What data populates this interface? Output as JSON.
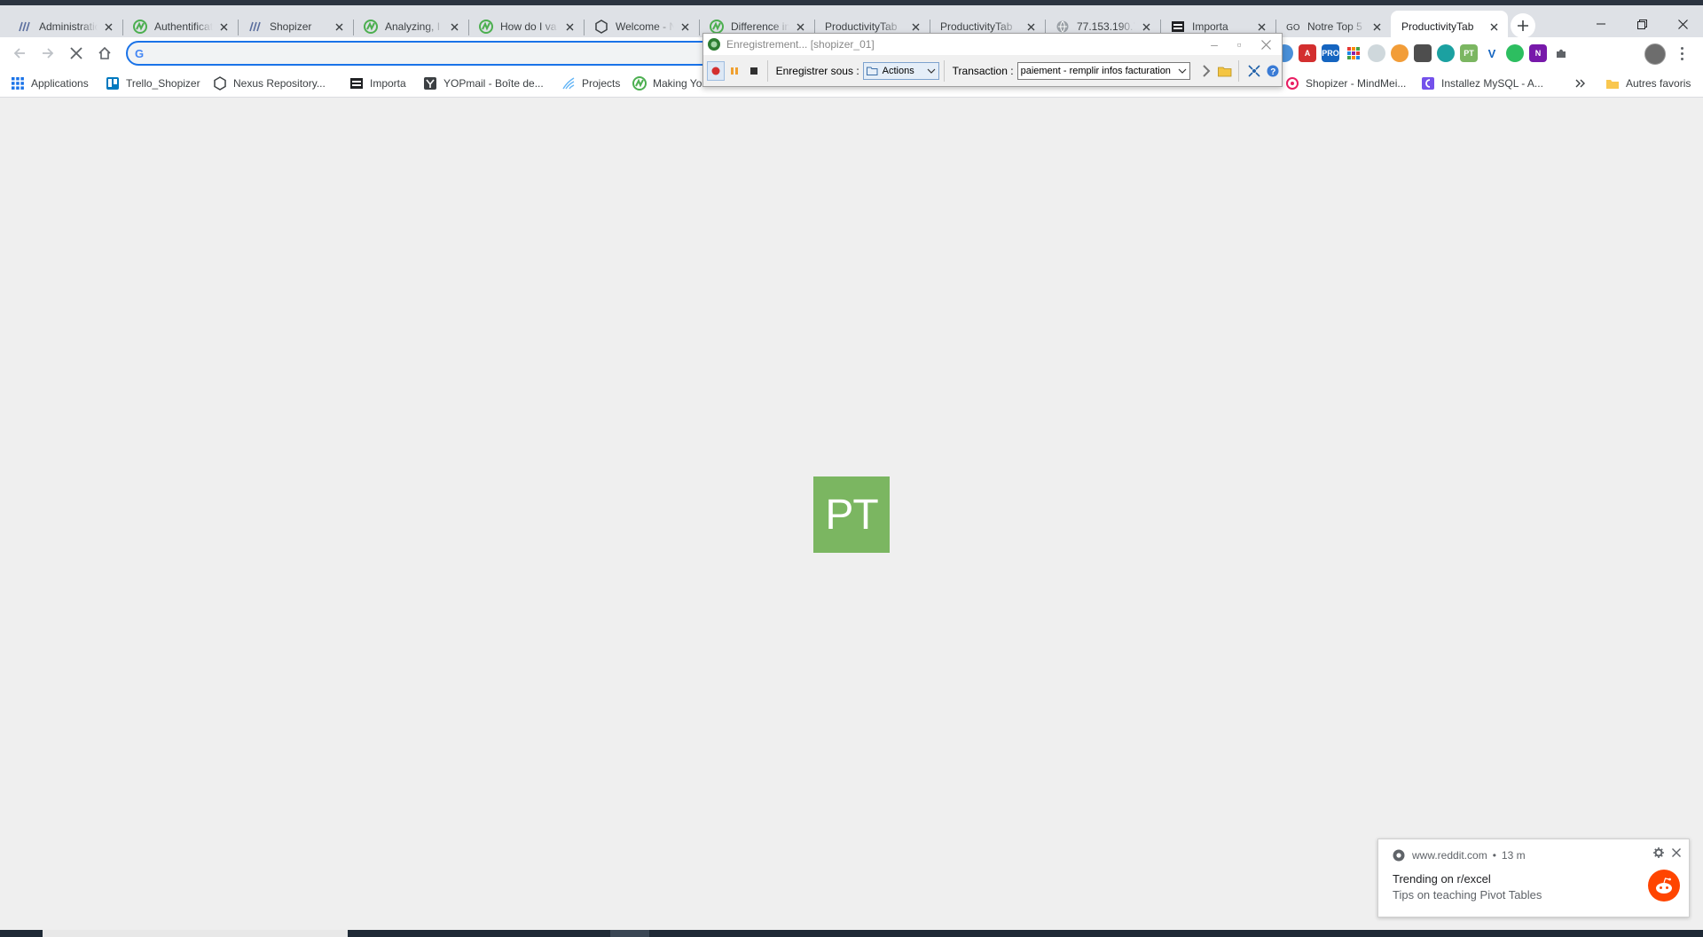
{
  "browser": {
    "tabs": [
      {
        "title": "Administratio",
        "icon": "hs-icon",
        "active": false
      },
      {
        "title": "Authentification",
        "icon": "n-green-icon",
        "active": false
      },
      {
        "title": "Shopizer",
        "icon": "hs-icon",
        "active": false
      },
      {
        "title": "Analyzing, I",
        "icon": "n-green-icon",
        "active": false
      },
      {
        "title": "How do I va",
        "icon": "n-green-icon",
        "active": false
      },
      {
        "title": "Welcome - N",
        "icon": "hexagon-icon",
        "active": false
      },
      {
        "title": "Difference in",
        "icon": "n-green-icon",
        "active": false
      },
      {
        "title": "ProductivityTab",
        "icon": "none",
        "active": false
      },
      {
        "title": "ProductivityTab",
        "icon": "none",
        "active": false
      },
      {
        "title": "77.153.190.7",
        "icon": "globe-icon",
        "active": false
      },
      {
        "title": "Importa",
        "icon": "importa-icon",
        "active": false
      },
      {
        "title": "Notre Top 5",
        "icon": "go-icon",
        "active": false
      },
      {
        "title": "ProductivityTab",
        "icon": "none",
        "active": true
      }
    ],
    "omnibox": {
      "value": "",
      "search_engine_icon": "G"
    },
    "bookmarks": [
      {
        "label": "Applications",
        "icon": "apps-grid-icon"
      },
      {
        "label": "Trello_Shopizer",
        "icon": "trello-icon"
      },
      {
        "label": "Nexus Repository...",
        "icon": "hexagon-icon"
      },
      {
        "label": "Importa",
        "icon": "importa-icon"
      },
      {
        "label": "YOPmail - Boîte de...",
        "icon": "yopmail-icon"
      },
      {
        "label": "Projects",
        "icon": "projects-icon"
      },
      {
        "label": "Making Yo",
        "icon": "n-green-icon"
      },
      {
        "label": "Shopizer - MindMei...",
        "icon": "mindmeister-icon"
      },
      {
        "label": "Installez MySQL - A...",
        "icon": "openclassrooms-icon"
      },
      {
        "label": "Autres favoris",
        "icon": "folder-icon"
      }
    ],
    "extensions": [
      "extension-blue-icon",
      "acrobat-icon",
      "pro-icon",
      "grid-icon",
      "feather-icon",
      "cookie-icon",
      "tool-icon",
      "circle-icon",
      "pt-icon",
      "v-icon",
      "evernote-icon",
      "onenote-icon",
      "puzzle-icon"
    ]
  },
  "recorder": {
    "title": "Enregistrement... [shopizer_01]",
    "save_label": "Enregistrer sous :",
    "save_value": "Actions",
    "transaction_label": "Transaction :",
    "transaction_value": "paiement - remplir infos facturation"
  },
  "main": {
    "logo_text": "PT",
    "logo_color": "#7bb661"
  },
  "notification": {
    "source": "www.reddit.com",
    "time": "13 m",
    "title": "Trending on r/excel",
    "body": "Tips on teaching Pivot Tables"
  }
}
